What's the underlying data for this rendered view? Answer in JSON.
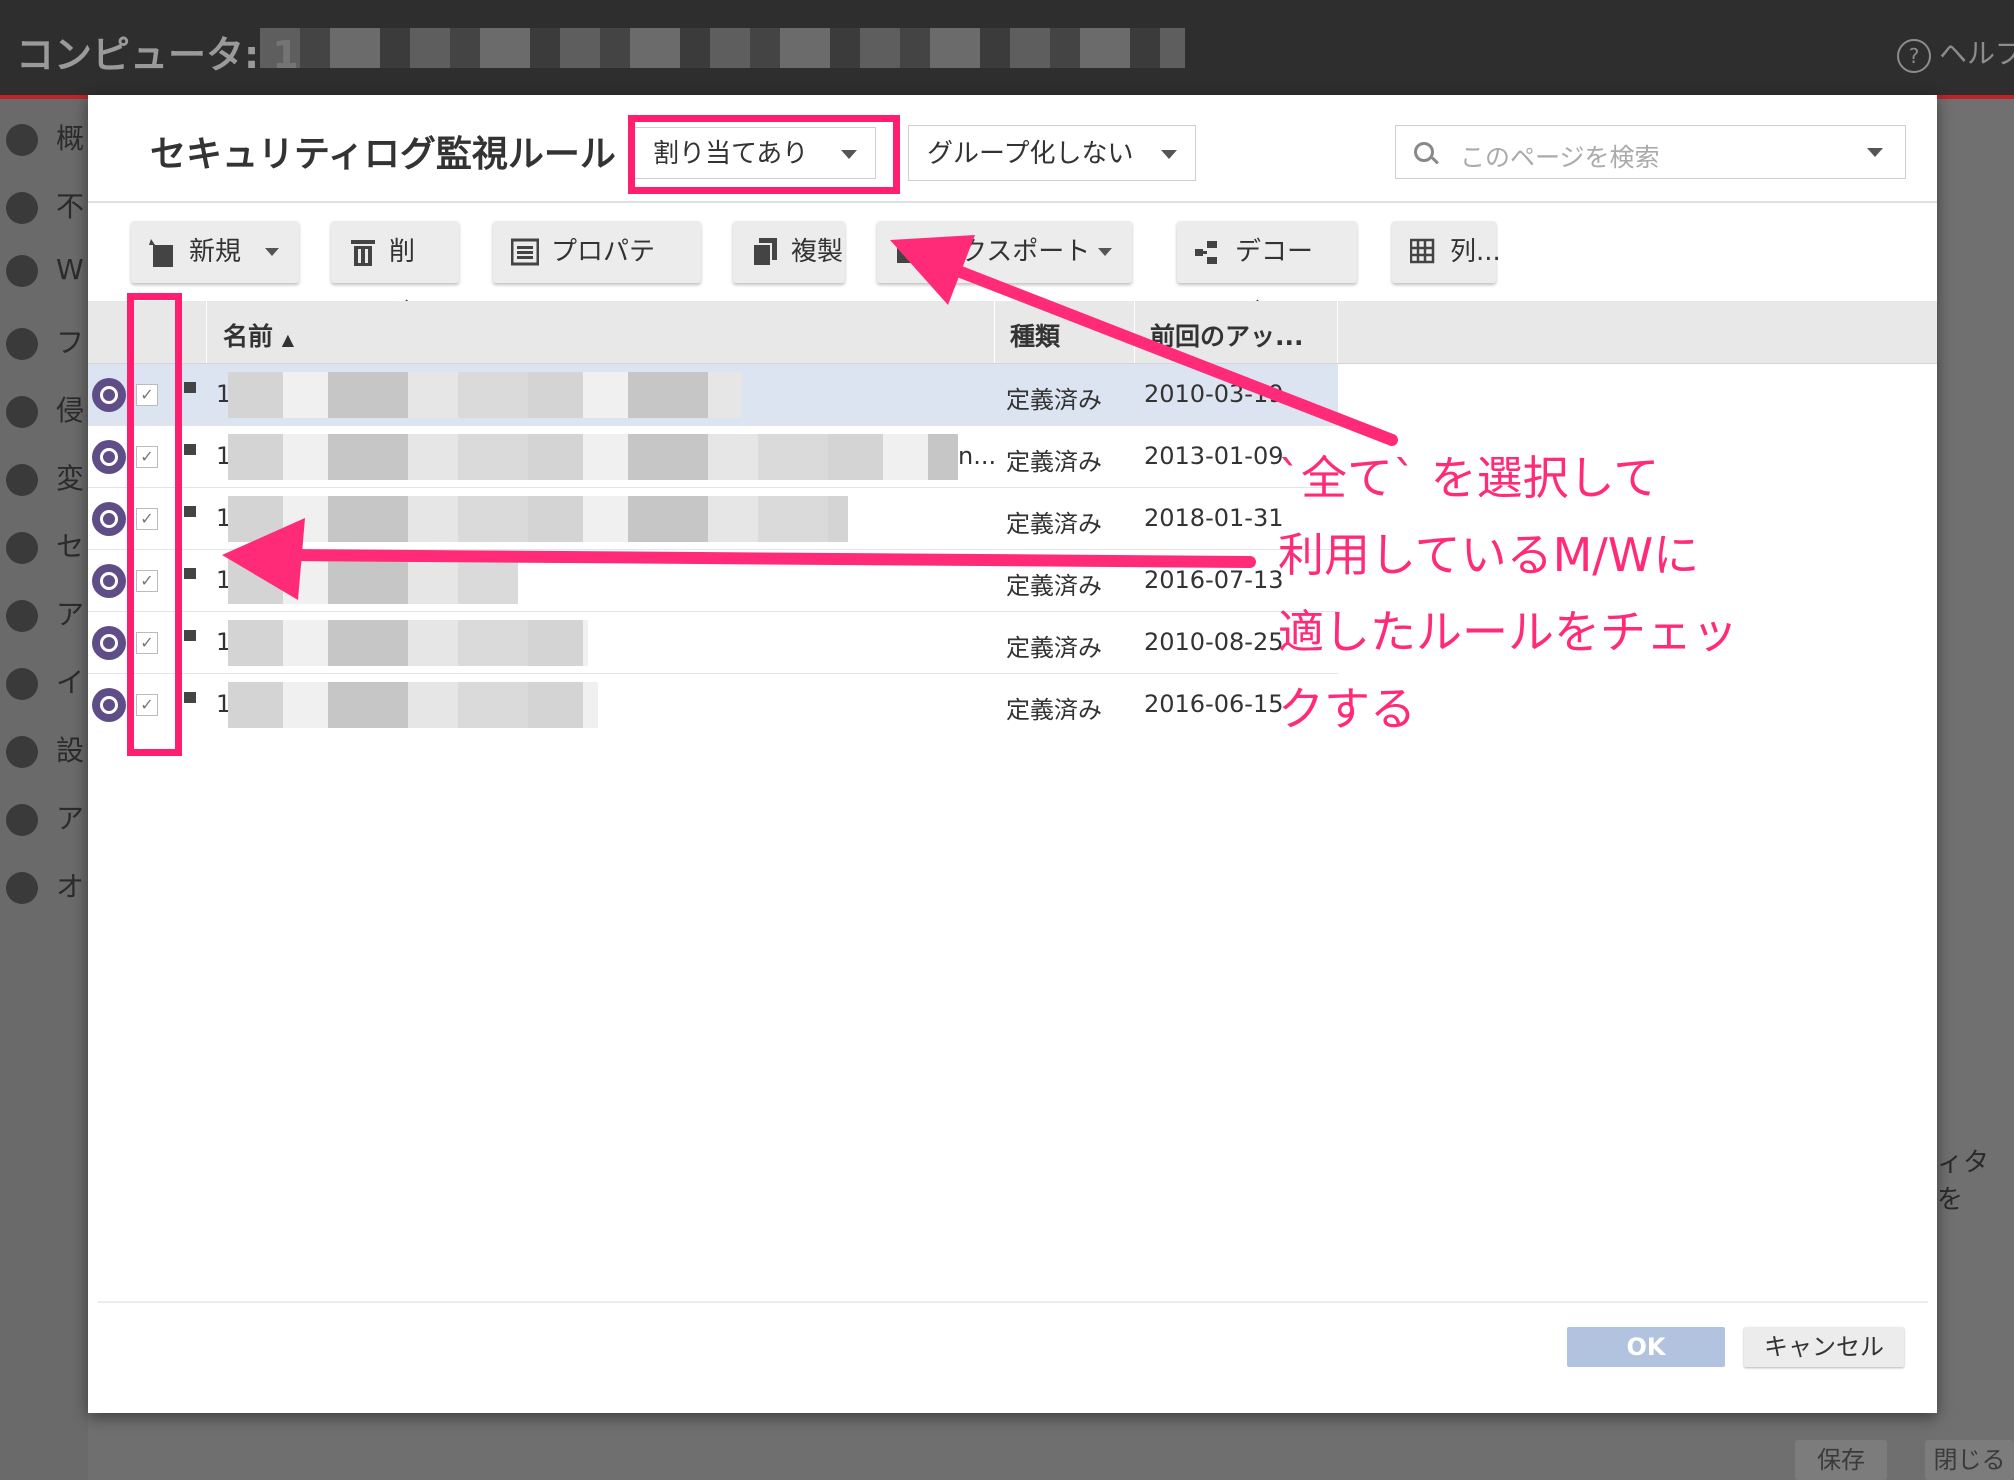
{
  "app": {
    "title": "コンピュータ: 1",
    "help_label": "ヘルプ",
    "sidebar_items": [
      "概",
      "不",
      "W",
      "フ",
      "侵",
      "変",
      "セ",
      "ア",
      "イ",
      "設",
      "ア",
      "オ"
    ],
    "right_panel_text": "ィタを",
    "save_label": "保存",
    "close_label": "閉じる"
  },
  "dialog": {
    "title": "セキュリティログ監視ルール",
    "filter_assigned": "割り当てあり",
    "filter_group": "グループ化しない",
    "search_placeholder": "このページを検索",
    "toolbar": {
      "new": "新規",
      "delete": "削除...",
      "properties": "プロパティ...",
      "duplicate": "複製",
      "export": "エクスポート",
      "decoder": "デコーダ...",
      "columns": "列..."
    },
    "columns": [
      "名前",
      "種類",
      "前回のアッ..."
    ],
    "rows": [
      {
        "name": "1",
        "type": "定義済み",
        "date": "2010-03-19",
        "selected": true
      },
      {
        "name": "1",
        "type": "定義済み",
        "date": "2013-01-09",
        "selected": false,
        "ellipsis": "n..."
      },
      {
        "name": "1",
        "type": "定義済み",
        "date": "2018-01-31",
        "selected": false
      },
      {
        "name": "1",
        "type": "定義済み",
        "date": "2016-07-13",
        "selected": false
      },
      {
        "name": "1",
        "type": "定義済み",
        "date": "2010-08-25",
        "selected": false
      },
      {
        "name": "1",
        "type": "定義済み",
        "date": "2016-06-15",
        "selected": false
      }
    ],
    "ok_label": "OK",
    "cancel_label": "キャンセル"
  },
  "annotation": {
    "lines": [
      "`全て` を選択して",
      "利用しているM/Wに",
      "適したルールをチェッ",
      "クする"
    ],
    "color": "#ff2b78"
  },
  "colors": {
    "accent": "#ff1f6e",
    "topbar": "#2e2e2e",
    "selected_row": "#dde4f1",
    "ok_button": "#b1c3de"
  }
}
